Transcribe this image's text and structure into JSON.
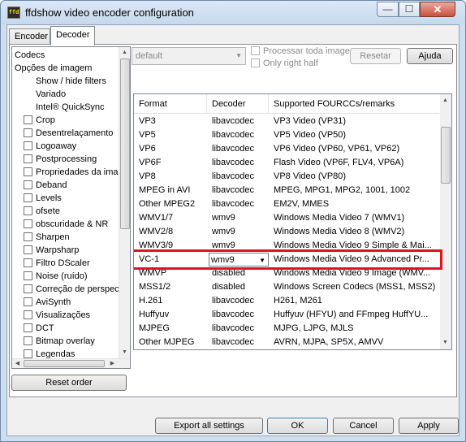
{
  "window": {
    "title": "ffdshow video encoder configuration",
    "app_icon_text": "ffd",
    "controls": {
      "minimize": "—",
      "maximize": "☐",
      "close": "✕"
    }
  },
  "tabs": [
    {
      "label": "Encoder",
      "selected": false
    },
    {
      "label": "Decoder",
      "selected": true
    }
  ],
  "tree": {
    "items": [
      {
        "label": "Codecs",
        "level": 0,
        "check": false
      },
      {
        "label": "Opções de imagem",
        "level": 0,
        "check": false
      },
      {
        "label": "Show / hide filters",
        "level": 1,
        "check": false
      },
      {
        "label": "Variado",
        "level": 1,
        "check": false
      },
      {
        "label": "Intel® QuickSync",
        "level": 1,
        "check": false
      },
      {
        "label": "Crop",
        "check": true
      },
      {
        "label": "Desentrelaçamento",
        "check": true
      },
      {
        "label": "Logoaway",
        "check": true
      },
      {
        "label": "Postprocessing",
        "check": true
      },
      {
        "label": "Propriedades da imagem",
        "check": true
      },
      {
        "label": "Deband",
        "check": true
      },
      {
        "label": "Levels",
        "check": true
      },
      {
        "label": "ofsete",
        "check": true
      },
      {
        "label": "obscuridade & NR",
        "check": true
      },
      {
        "label": "Sharpen",
        "check": true
      },
      {
        "label": "Warpsharp",
        "check": true
      },
      {
        "label": "Filtro DScaler",
        "check": true
      },
      {
        "label": "Noise (ruído)",
        "check": true
      },
      {
        "label": "Correção de perspectiva",
        "check": true
      },
      {
        "label": "AviSynth",
        "check": true
      },
      {
        "label": "Visualizações",
        "check": true
      },
      {
        "label": "DCT",
        "check": true
      },
      {
        "label": "Bitmap overlay",
        "check": true
      },
      {
        "label": "Legendas",
        "check": true
      }
    ],
    "reset_order_label": "Reset order"
  },
  "preset": {
    "value": "default",
    "processar_label": "Processar toda imagem",
    "only_right_half_label": "Only right half",
    "resetar_label": "Resetar",
    "ajuda_label": "Ajuda"
  },
  "codec_table": {
    "columns": [
      "Format",
      "Decoder",
      "Supported FOURCCs/remarks"
    ],
    "rows": [
      {
        "format": "VP3",
        "decoder": "libavcodec",
        "remarks": "VP3 Video (VP31)"
      },
      {
        "format": "VP5",
        "decoder": "libavcodec",
        "remarks": "VP5 Video (VP50)"
      },
      {
        "format": "VP6",
        "decoder": "libavcodec",
        "remarks": "VP6 Video (VP60, VP61, VP62)"
      },
      {
        "format": "VP6F",
        "decoder": "libavcodec",
        "remarks": "Flash Video (VP6F, FLV4, VP6A)"
      },
      {
        "format": "VP8",
        "decoder": "libavcodec",
        "remarks": "VP8 Video (VP80)"
      },
      {
        "format": "MPEG in AVI",
        "decoder": "libavcodec",
        "remarks": "MPEG, MPG1, MPG2, 1001, 1002"
      },
      {
        "format": "Other MPEG2",
        "decoder": "libavcodec",
        "remarks": "EM2V, MMES"
      },
      {
        "format": "WMV1/7",
        "decoder": "wmv9",
        "remarks": "Windows Media Video 7 (WMV1)"
      },
      {
        "format": "WMV2/8",
        "decoder": "wmv9",
        "remarks": "Windows Media Video 8 (WMV2)"
      },
      {
        "format": "WMV3/9",
        "decoder": "wmv9",
        "remarks": "Windows Media Video 9 Simple & Mai..."
      },
      {
        "format": "VC-1",
        "decoder": "wmv9",
        "remarks": "Windows Media Video 9 Advanced Pr...",
        "editing": true
      },
      {
        "format": "WMVP",
        "decoder": "disabled",
        "remarks": "Windows Media Video 9 Image (WMV..."
      },
      {
        "format": "MSS1/2",
        "decoder": "disabled",
        "remarks": "Windows Screen Codecs (MSS1, MSS2)"
      },
      {
        "format": "H.261",
        "decoder": "libavcodec",
        "remarks": "H261, M261"
      },
      {
        "format": "Huffyuv",
        "decoder": "libavcodec",
        "remarks": "Huffyuv (HFYU) and FFmpeg HuffYU..."
      },
      {
        "format": "MJPEG",
        "decoder": "libavcodec",
        "remarks": "MJPG, LJPG, MJLS"
      },
      {
        "format": "Other MJPEG",
        "decoder": "libavcodec",
        "remarks": "AVRN, MJPA, SP5X, AMVV"
      }
    ]
  },
  "footer": {
    "export_label": "Export all settings",
    "ok_label": "OK",
    "cancel_label": "Cancel",
    "apply_label": "Apply"
  },
  "colors": {
    "highlight": "#e0151b",
    "window_frame": "#cfdeee",
    "face": "#f0f0f0"
  }
}
